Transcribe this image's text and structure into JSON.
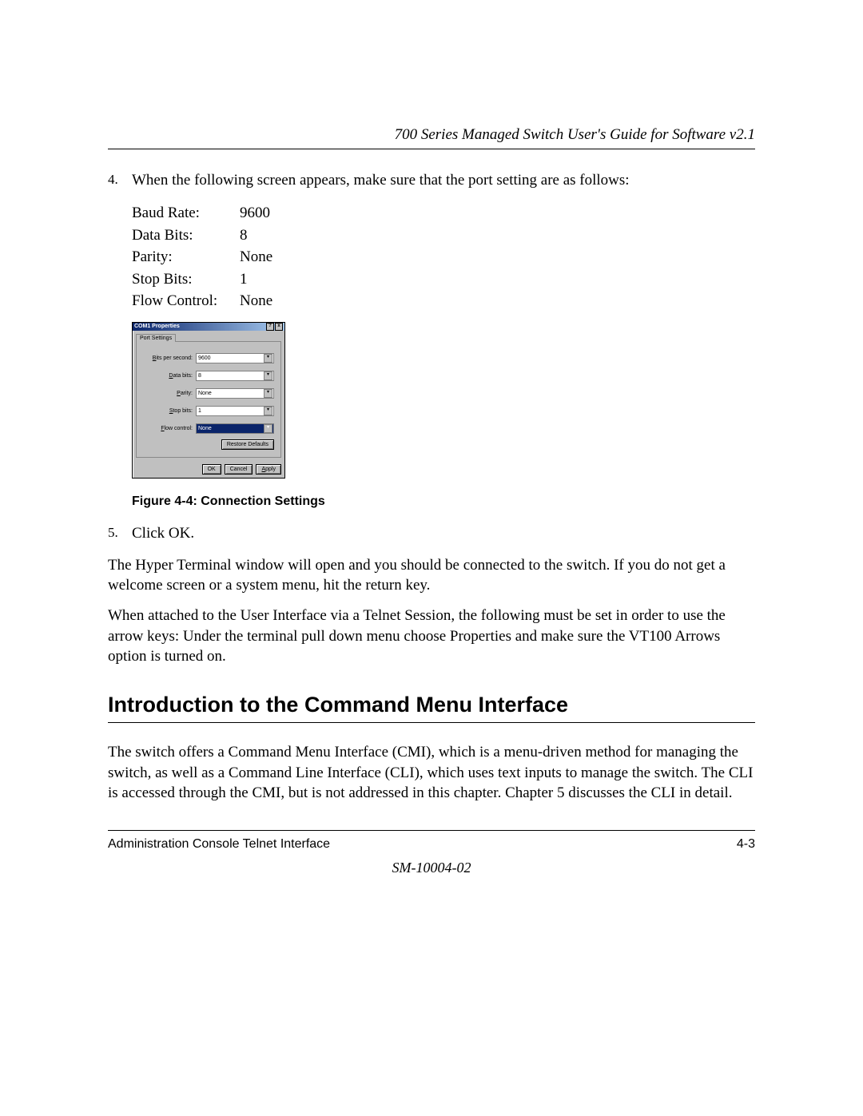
{
  "header": {
    "running_head": "700 Series Managed Switch User's Guide for Software v2.1"
  },
  "step4": {
    "number": "4.",
    "text": "When the following screen appears, make sure that the port setting are as follows:"
  },
  "settings": {
    "rows": [
      {
        "label": "Baud Rate:",
        "value": "9600"
      },
      {
        "label": "Data Bits:",
        "value": "8"
      },
      {
        "label": "Parity:",
        "value": "None"
      },
      {
        "label": "Stop Bits:",
        "value": "1"
      },
      {
        "label": "Flow Control:",
        "value": "None"
      }
    ]
  },
  "dialog": {
    "title": "COM1 Properties",
    "help_btn": "?",
    "close_btn": "x",
    "tab": "Port Settings",
    "fields": {
      "bps": {
        "label": "Bits per second:",
        "value": "9600"
      },
      "data": {
        "label": "Data bits:",
        "value": "8"
      },
      "parity": {
        "label": "Parity:",
        "value": "None"
      },
      "stop": {
        "label": "Stop bits:",
        "value": "1"
      },
      "flow": {
        "label": "Flow control:",
        "value": "None"
      }
    },
    "restore": "Restore Defaults",
    "ok": "OK",
    "cancel": "Cancel",
    "apply": "Apply"
  },
  "figure_caption": "Figure 4-4:  Connection Settings",
  "step5": {
    "number": "5.",
    "text": "Click OK."
  },
  "para1": "The Hyper Terminal window will open and you should be connected to the switch.  If you do not get a welcome screen or a system menu, hit the return key.",
  "para2": "When attached to the User Interface via a Telnet Session, the following must be set in order to use the arrow keys: Under the terminal pull down menu choose Properties and make sure the VT100 Arrows option is turned on.",
  "h2": "Introduction to the Command Menu Interface",
  "para3": "The switch offers a Command Menu Interface (CMI), which is a menu-driven method for managing the switch, as well as a Command Line Interface (CLI), which uses text inputs to manage the switch.  The CLI is accessed through the CMI, but is not addressed in this chapter.  Chapter 5 discusses the CLI in detail.",
  "footer": {
    "left": "Administration Console Telnet Interface",
    "right": "4-3",
    "docid": "SM-10004-02"
  }
}
